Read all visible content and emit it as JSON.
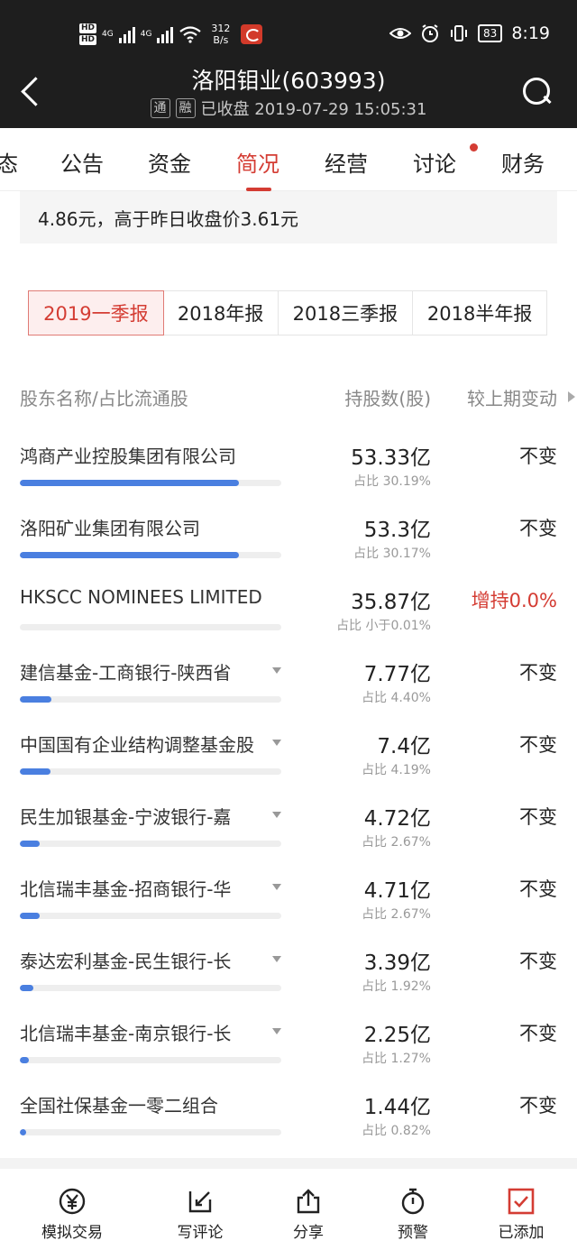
{
  "status_bar": {
    "hd1": "HD",
    "hd2": "HD",
    "net1": "4G",
    "net2": "4G",
    "speed_value": "312",
    "speed_unit": "B/s",
    "battery": "83",
    "time": "8:19"
  },
  "header": {
    "title": "洛阳钼业(603993)",
    "tag1": "通",
    "tag2": "融",
    "status": "已收盘 2019-07-29 15:05:31"
  },
  "tabs": [
    {
      "label": "态"
    },
    {
      "label": "公告"
    },
    {
      "label": "资金"
    },
    {
      "label": "简况"
    },
    {
      "label": "经营"
    },
    {
      "label": "讨论"
    },
    {
      "label": "财务"
    }
  ],
  "info_card": {
    "text": "4.86元，高于昨日收盘价3.61元"
  },
  "periods": [
    {
      "label": "2019一季报"
    },
    {
      "label": "2018年报"
    },
    {
      "label": "2018三季报"
    },
    {
      "label": "2018半年报"
    }
  ],
  "table": {
    "headers": {
      "name": "股东名称/占比流通股",
      "shares": "持股数(股)",
      "change": "较上期变动"
    },
    "rows": [
      {
        "name": "鸿商产业控股集团有限公司",
        "value": "53.33亿",
        "pct": "占比 30.19%",
        "change": "不变",
        "share_fraction": 0.8396
      },
      {
        "name": "洛阳矿业集团有限公司",
        "value": "53.3亿",
        "pct": "占比 30.17%",
        "change": "不变",
        "share_fraction": 0.8372
      },
      {
        "name": "HKSCC NOMINEES LIMITED",
        "value": "35.87亿",
        "pct": "占比 小于0.01%",
        "change": "增持0.0%",
        "share_fraction": 0.0
      },
      {
        "name": "建信基金-工商银行-陕西省",
        "value": "7.77亿",
        "pct": "占比 4.40%",
        "change": "不变",
        "share_fraction": 0.1224
      },
      {
        "name": "中国国有企业结构调整基金股",
        "value": "7.4亿",
        "pct": "占比 4.19%",
        "change": "不变",
        "share_fraction": 0.1166
      },
      {
        "name": "民生加银基金-宁波银行-嘉",
        "value": "4.72亿",
        "pct": "占比 2.67%",
        "change": "不变",
        "share_fraction": 0.0743
      },
      {
        "name": "北信瑞丰基金-招商银行-华",
        "value": "4.71亿",
        "pct": "占比 2.67%",
        "change": "不变",
        "share_fraction": 0.0743
      },
      {
        "name": "泰达宏利基金-民生银行-长",
        "value": "3.39亿",
        "pct": "占比 1.92%",
        "change": "不变",
        "share_fraction": 0.0534
      },
      {
        "name": "北信瑞丰基金-南京银行-长",
        "value": "2.25亿",
        "pct": "占比 1.27%",
        "change": "不变",
        "share_fraction": 0.0353
      },
      {
        "name": "全国社保基金一零二组合",
        "value": "1.44亿",
        "pct": "占比 0.82%",
        "change": "不变",
        "share_fraction": 0.0228
      }
    ]
  },
  "bottom_bar": [
    {
      "label": "模拟交易",
      "icon": "yen-circle-icon"
    },
    {
      "label": "写评论",
      "icon": "pencil-icon"
    },
    {
      "label": "分享",
      "icon": "share-icon"
    },
    {
      "label": "预警",
      "icon": "stopwatch-icon"
    },
    {
      "label": "已添加",
      "icon": "checkbox-icon"
    }
  ],
  "colors": {
    "accent": "#d43c33",
    "bar": "#4a7fe0",
    "header_bg": "#1e1e1e"
  }
}
